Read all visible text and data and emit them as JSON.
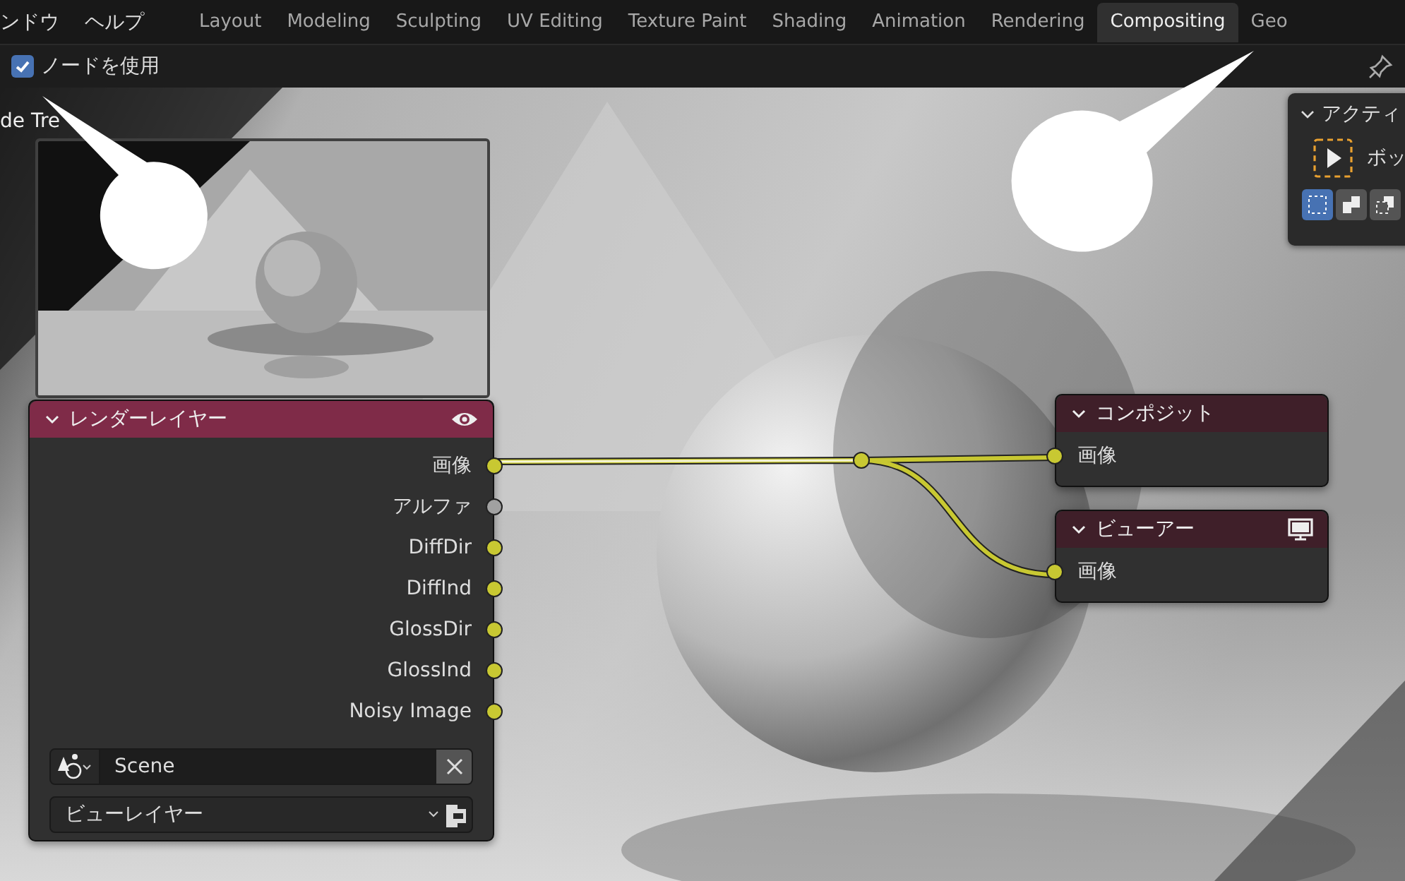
{
  "menu": [
    "ンドウ",
    "ヘルプ"
  ],
  "tabs": [
    {
      "label": "Layout",
      "selected": false
    },
    {
      "label": "Modeling",
      "selected": false
    },
    {
      "label": "Sculpting",
      "selected": false
    },
    {
      "label": "UV Editing",
      "selected": false
    },
    {
      "label": "Texture Paint",
      "selected": false
    },
    {
      "label": "Shading",
      "selected": false
    },
    {
      "label": "Animation",
      "selected": false
    },
    {
      "label": "Rendering",
      "selected": false
    },
    {
      "label": "Compositing",
      "selected": true
    },
    {
      "label": "Geo",
      "selected": false
    }
  ],
  "header": {
    "use_nodes": {
      "label": "ノードを使用",
      "checked": true
    }
  },
  "canvas": {
    "tree_label": "de Tre"
  },
  "render_layers_node": {
    "title": "レンダーレイヤー",
    "outputs": [
      {
        "label": "画像",
        "color": "#c8c832"
      },
      {
        "label": "アルファ",
        "color": "#a1a1a1"
      },
      {
        "label": "DiffDir",
        "color": "#c8c832"
      },
      {
        "label": "DiffInd",
        "color": "#c8c832"
      },
      {
        "label": "GlossDir",
        "color": "#c8c832"
      },
      {
        "label": "GlossInd",
        "color": "#c8c832"
      },
      {
        "label": "Noisy Image",
        "color": "#c8c832"
      }
    ],
    "scene": "Scene",
    "view_layer": "ビューレイヤー"
  },
  "output_nodes": [
    {
      "kind": "composite",
      "title": "コンポジット",
      "inputs": [
        "画像"
      ]
    },
    {
      "kind": "viewer",
      "title": "ビューアー",
      "inputs": [
        "画像"
      ]
    }
  ],
  "side_panel": {
    "title": "アクティ",
    "tool": "ボッ",
    "modes": [
      {
        "selected": true
      },
      {
        "selected": false
      },
      {
        "selected": false
      }
    ]
  }
}
